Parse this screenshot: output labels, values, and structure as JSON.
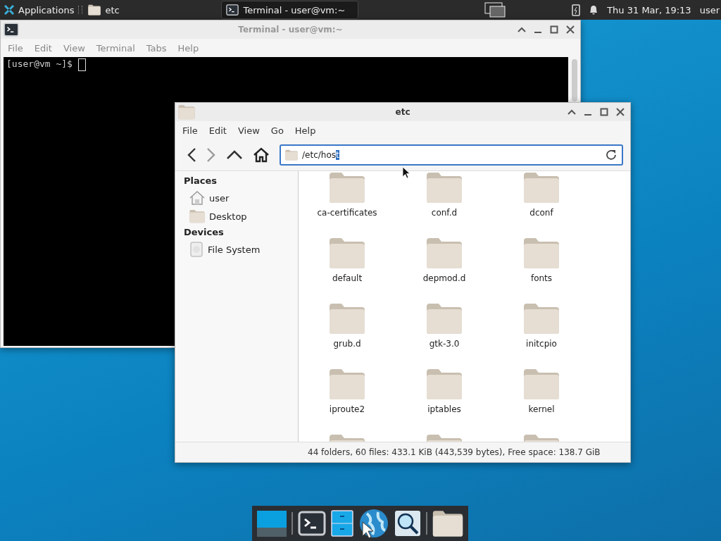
{
  "top_panel": {
    "apps_menu": "Applications",
    "tasks": [
      {
        "label": "etc",
        "kind": "folder",
        "selected": false
      },
      {
        "label": "Terminal - user@vm:~",
        "kind": "terminal",
        "selected": true
      }
    ],
    "clock": "Thu 31 Mar, 19:13",
    "user": "user"
  },
  "terminal_window": {
    "title": "Terminal - user@vm:~",
    "menu": [
      "File",
      "Edit",
      "View",
      "Terminal",
      "Tabs",
      "Help"
    ],
    "prompt": "[user@vm ~]$"
  },
  "file_manager": {
    "title": "etc",
    "menu": [
      "File",
      "Edit",
      "View",
      "Go",
      "Help"
    ],
    "address": {
      "value": "/etc/hos",
      "selection": "t"
    },
    "sidebar": [
      {
        "heading": "Places",
        "items": [
          {
            "label": "user",
            "kind": "home"
          },
          {
            "label": "Desktop",
            "kind": "desktop"
          }
        ]
      },
      {
        "heading": "Devices",
        "items": [
          {
            "label": "File System",
            "kind": "drive"
          }
        ]
      }
    ],
    "folders": [
      "ca-certificates",
      "conf.d",
      "dconf",
      "default",
      "depmod.d",
      "fonts",
      "grub.d",
      "gtk-3.0",
      "initcpio",
      "iproute2",
      "iptables",
      "kernel"
    ],
    "status_bar": "44 folders, 60 files: 433.1 KiB (443,539 bytes), Free space: 138.7 GiB"
  },
  "dock": [
    {
      "kind": "desktop"
    },
    {
      "kind": "terminal"
    },
    {
      "kind": "cabinet"
    },
    {
      "kind": "globe"
    },
    {
      "kind": "search"
    },
    {
      "kind": "folder"
    }
  ]
}
